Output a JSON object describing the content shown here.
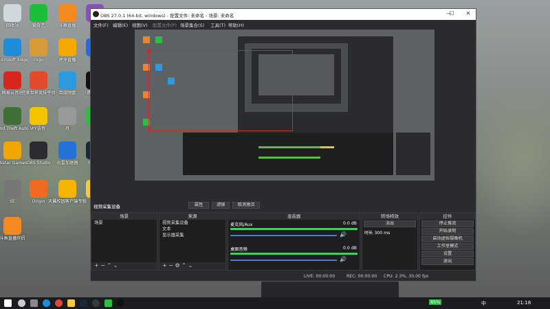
{
  "desktop_icons": [
    {
      "label": "回收站",
      "color": "#cfd8dc"
    },
    {
      "label": "爱奇艺",
      "color": "#1bbf3a"
    },
    {
      "label": "斗鱼直播",
      "color": "#f28a1f"
    },
    {
      "label": "Pow",
      "color": "#8a4fb8"
    },
    {
      "label": "Microsoft Edge",
      "color": "#1e8cd8"
    },
    {
      "label": "csgo",
      "color": "#d79b3a"
    },
    {
      "label": "虎牙直播",
      "color": "#f7a800"
    },
    {
      "label": "V",
      "color": "#2a6ad6"
    },
    {
      "label": "网易云音乐",
      "color": "#d7261e"
    },
    {
      "label": "完美世界竞技平台",
      "color": "#e44a2c"
    },
    {
      "label": "百度网盘",
      "color": "#2d9ae0"
    },
    {
      "label": "腾讯QQ",
      "color": "#111"
    },
    {
      "label": "Grand Theft Auto V",
      "color": "#3f6f36"
    },
    {
      "label": "YY语音",
      "color": "#f5c400"
    },
    {
      "label": "月",
      "color": "#999"
    },
    {
      "label": "微信",
      "color": "#2ebb46"
    },
    {
      "label": "Rockstar Games ...",
      "color": "#f2a600"
    },
    {
      "label": "OBS Studio",
      "color": "#2c2c30"
    },
    {
      "label": "迅雷加速器",
      "color": "#2472d8"
    },
    {
      "label": "Steam",
      "color": "#1b2838"
    },
    {
      "label": "SE",
      "color": "#777"
    },
    {
      "label": "Origin",
      "color": "#f06a20"
    },
    {
      "label": "天翼校园客户端专版",
      "color": "#f5b400"
    },
    {
      "label": "捕获",
      "color": "#f2c94c"
    },
    {
      "label": "斗鱼直播伴侣",
      "color": "#f28a1f"
    }
  ],
  "window": {
    "title": "OBS 27.0.1 (64-bit, windows) - 配置文件: 未命名 - 场景: 未命名",
    "minimize": "—",
    "maximize": "☐",
    "close": "✕"
  },
  "menu": [
    "文件(F)",
    "编辑(E)",
    "视图(V)",
    "配置文件(P)",
    "场景集合(S)",
    "工具(T)",
    "帮助(H)"
  ],
  "controls_row": {
    "source_name": "视频采集设备",
    "properties": "属性",
    "filters": "滤镜",
    "deactivate": "取消激活"
  },
  "scenes": {
    "title": "场景",
    "items": [
      "场景"
    ]
  },
  "sources": {
    "title": "来源",
    "items": [
      "视频采集设备",
      "文本",
      "显示器采集"
    ]
  },
  "mixer": {
    "title": "混音器",
    "tracks": [
      {
        "name": "麦克风/Aux",
        "db": "0.0 dB",
        "level": 0.75
      },
      {
        "name": "桌面音频",
        "db": "0.0 dB",
        "level": 0.8
      }
    ]
  },
  "transitions": {
    "title": "转场特效",
    "type": "淡出",
    "duration_label": "时长",
    "duration": "300 ms"
  },
  "controls": {
    "title": "控件",
    "buttons": [
      "停止推流",
      "开始录制",
      "启动虚拟摄像机",
      "工作室模式",
      "设置",
      "退出"
    ]
  },
  "status": {
    "live": "LIVE: 00:00:00",
    "rec": "REC: 00:00:00",
    "cpu": "CPU: 2.3%, 30.00 fps"
  },
  "taskbar": {
    "battery": "85%",
    "ime": "中",
    "clock": "21:18"
  },
  "icons": [
    "windows-icon",
    "search-icon",
    "taskview-icon",
    "edge-icon",
    "chrome-icon",
    "explorer-icon",
    "steam-icon",
    "obs-icon",
    "wechat-icon",
    "qq-icon"
  ]
}
